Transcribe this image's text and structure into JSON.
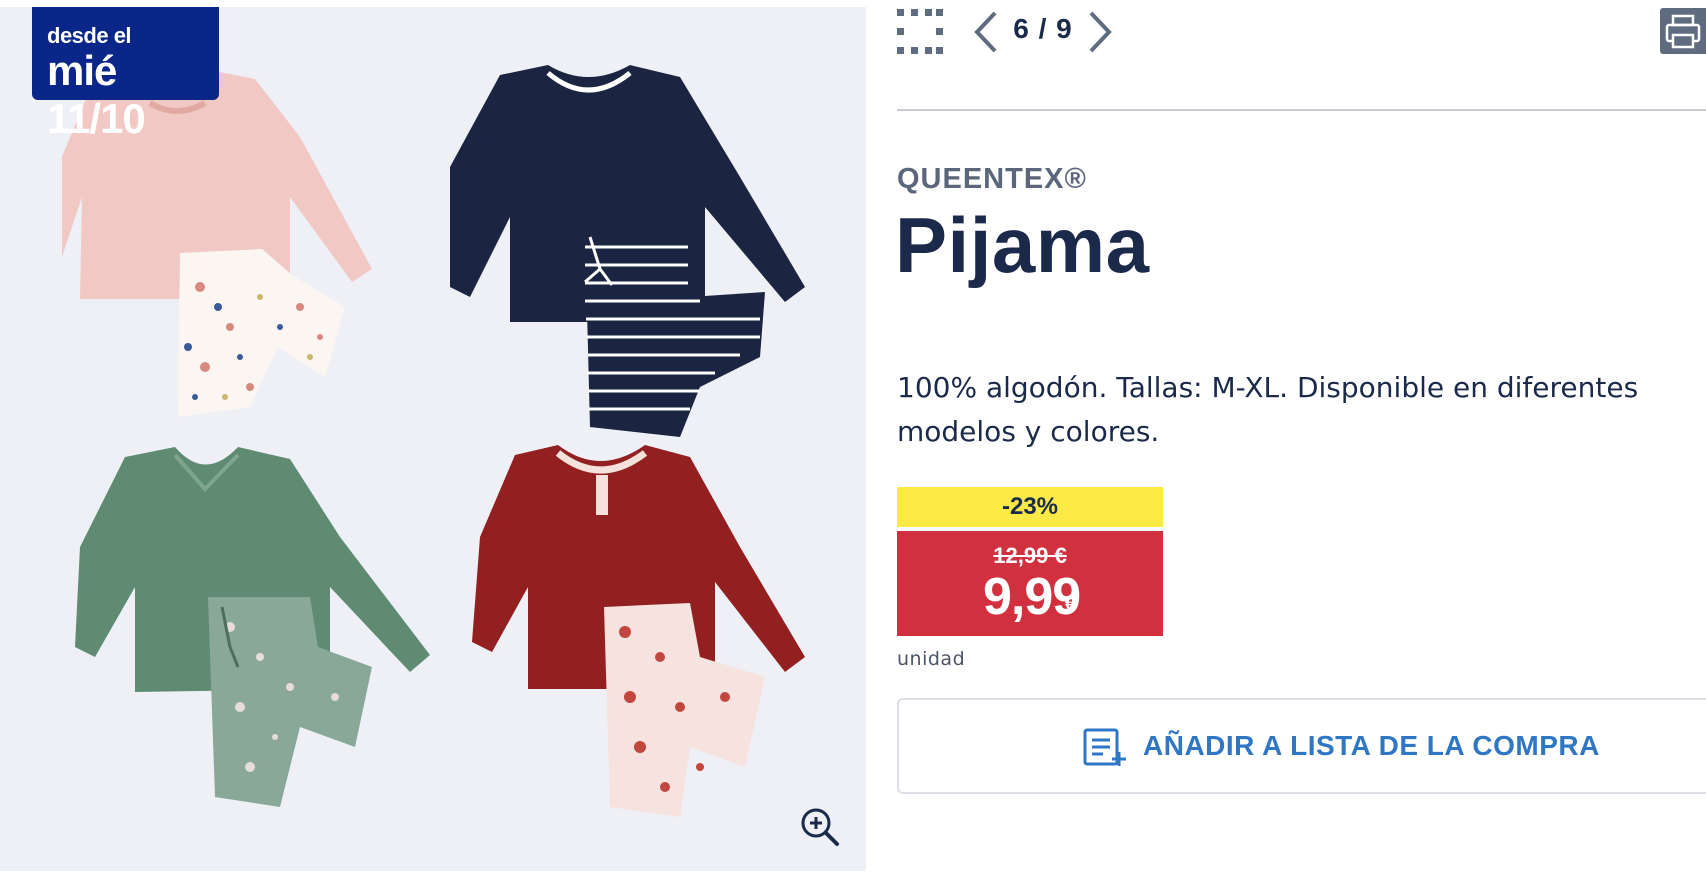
{
  "badge": {
    "line1": "desde el",
    "line2": "mié 11/10"
  },
  "gallery": {
    "counter": "6 / 9",
    "zoom_icon": "zoom-in-icon",
    "grid_icon": "grid-icon",
    "prev_icon": "chevron-left-icon",
    "next_icon": "chevron-right-icon",
    "print_icon": "printer-icon"
  },
  "product": {
    "brand": "QUEENTEX®",
    "title": "Pijama",
    "description": "100% algodón. Tallas: M-XL. Disponible en diferentes modelos y colores."
  },
  "price": {
    "discount": "-23%",
    "old": "12,99 €",
    "current": "9,99",
    "currency": "€",
    "unit": "unidad"
  },
  "actions": {
    "add_to_list": "AÑADIR A LISTA DE LA COMPRA",
    "add_to_list_icon": "list-add-icon"
  },
  "colors": {
    "badge_bg": "#0a2688",
    "discount_bg": "#fbe946",
    "price_bg": "#d1303f",
    "accent_link": "#2f77c4",
    "title": "#1b2a4a"
  }
}
